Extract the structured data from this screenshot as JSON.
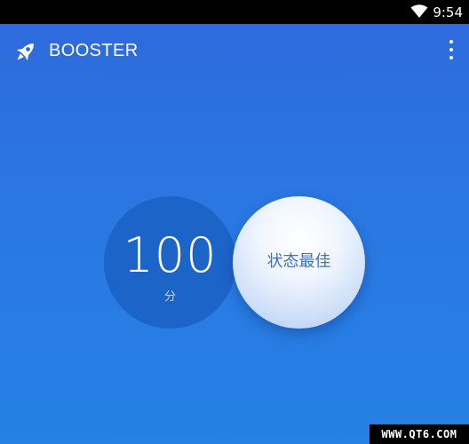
{
  "status_bar": {
    "time": "9:54",
    "icons": [
      "wifi-icon"
    ]
  },
  "app_bar": {
    "logo_icon": "rocket-icon",
    "title": "BOOSTER",
    "menu_icon": "more-vert-icon"
  },
  "score": {
    "value": "100",
    "unit": "分"
  },
  "status_button": {
    "label": "状态最佳"
  },
  "watermark": {
    "text": "WWW.QT6.COM"
  },
  "colors": {
    "background_top": "#2e69dd",
    "background_bottom": "#2581e4",
    "score_circle": "#1d64c8",
    "status_text": "#3d72c4"
  }
}
